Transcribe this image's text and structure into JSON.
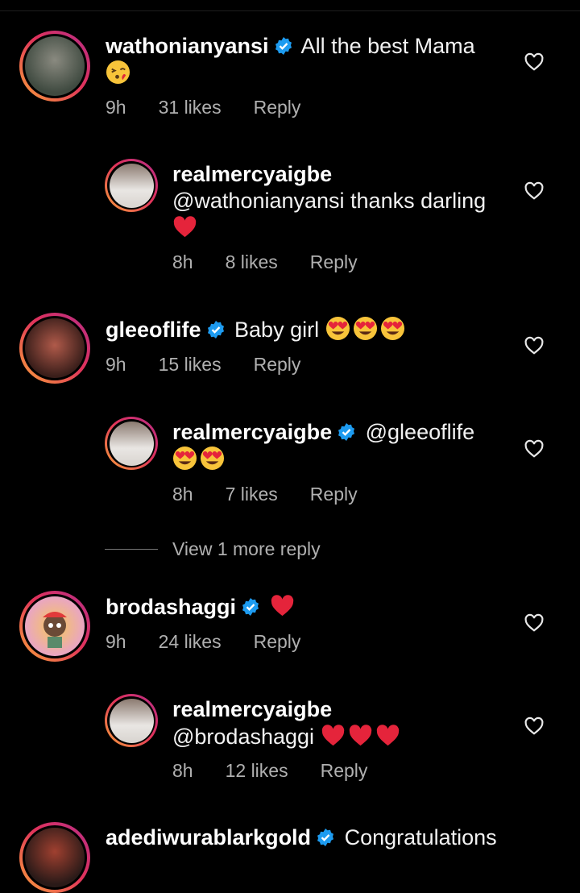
{
  "comments": [
    {
      "user": "wathonianyansi",
      "verified": true,
      "text": " All the best Mama",
      "emojis": [
        "kiss"
      ],
      "time": "9h",
      "likes": "31 likes",
      "reply": "Reply"
    },
    {
      "user": "realmercyaigbe",
      "verified": false,
      "text": "@wathonianyansi thanks darling",
      "emojis": [
        "red-heart"
      ],
      "time": "8h",
      "likes": "8 likes",
      "reply": "Reply"
    },
    {
      "user": "gleeoflife",
      "verified": true,
      "text": " Baby girl ",
      "emojis": [
        "heart-eyes",
        "heart-eyes",
        "heart-eyes"
      ],
      "time": "9h",
      "likes": "15 likes",
      "reply": "Reply"
    },
    {
      "user": "realmercyaigbe",
      "verified": true,
      "text": " @gleeoflife",
      "emojis": [
        "heart-eyes",
        "heart-eyes"
      ],
      "time": "8h",
      "likes": "7 likes",
      "reply": "Reply"
    },
    {
      "user": "brodashaggi",
      "verified": true,
      "text": " ",
      "emojis": [
        "red-heart"
      ],
      "time": "9h",
      "likes": "24 likes",
      "reply": "Reply"
    },
    {
      "user": "realmercyaigbe",
      "verified": false,
      "text": "@brodashaggi ",
      "emojis": [
        "red-heart",
        "red-heart",
        "red-heart"
      ],
      "time": "8h",
      "likes": "12 likes",
      "reply": "Reply"
    },
    {
      "user": "adediwurablarkgold",
      "verified": true,
      "text": " Congratulations",
      "emojis": []
    }
  ],
  "view_more": "View 1 more reply",
  "colors": {
    "background": "#000000",
    "verified": "#1d9bf0",
    "meta": "#b0b0b0",
    "ring_start": "#f9a13a",
    "ring_end": "#b52d88"
  }
}
